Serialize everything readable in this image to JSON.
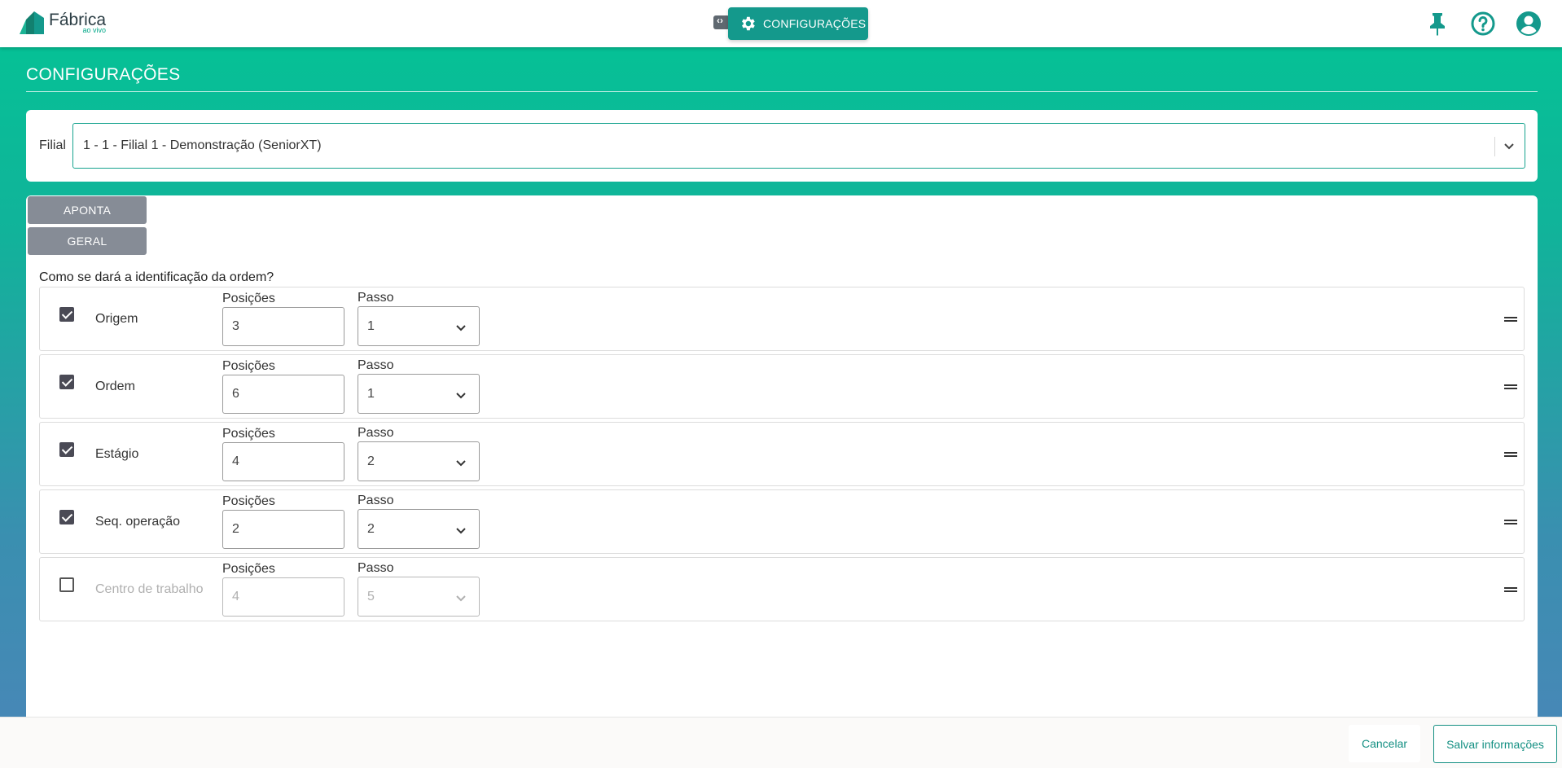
{
  "header": {
    "logo_name": "Fábrica",
    "logo_sub": "ao vivo",
    "config_button": "CONFIGURAÇÕES",
    "icons": [
      "pin-icon",
      "help-icon",
      "account-icon"
    ]
  },
  "page": {
    "title": "CONFIGURAÇÕES"
  },
  "filial": {
    "label": "Filial",
    "value": "1 - 1 - Filial 1 - Demonstração (SeniorXT)"
  },
  "tabs": [
    {
      "label": "APONTA"
    },
    {
      "label": "GERAL"
    }
  ],
  "section": {
    "question": "Como se dará a identificação da ordem?",
    "positions_label": "Posições",
    "step_label": "Passo"
  },
  "rows": [
    {
      "label": "Origem",
      "checked": true,
      "posicoes": "3",
      "passo": "1"
    },
    {
      "label": "Ordem",
      "checked": true,
      "posicoes": "6",
      "passo": "1"
    },
    {
      "label": "Estágio",
      "checked": true,
      "posicoes": "4",
      "passo": "2"
    },
    {
      "label": "Seq. operação",
      "checked": true,
      "posicoes": "2",
      "passo": "2"
    },
    {
      "label": "Centro de trabalho",
      "checked": false,
      "posicoes": "4",
      "passo": "5"
    }
  ],
  "footer": {
    "cancel": "Cancelar",
    "save": "Salvar informações"
  },
  "colors": {
    "accent": "#14998c",
    "tab_gray": "#868c96"
  }
}
